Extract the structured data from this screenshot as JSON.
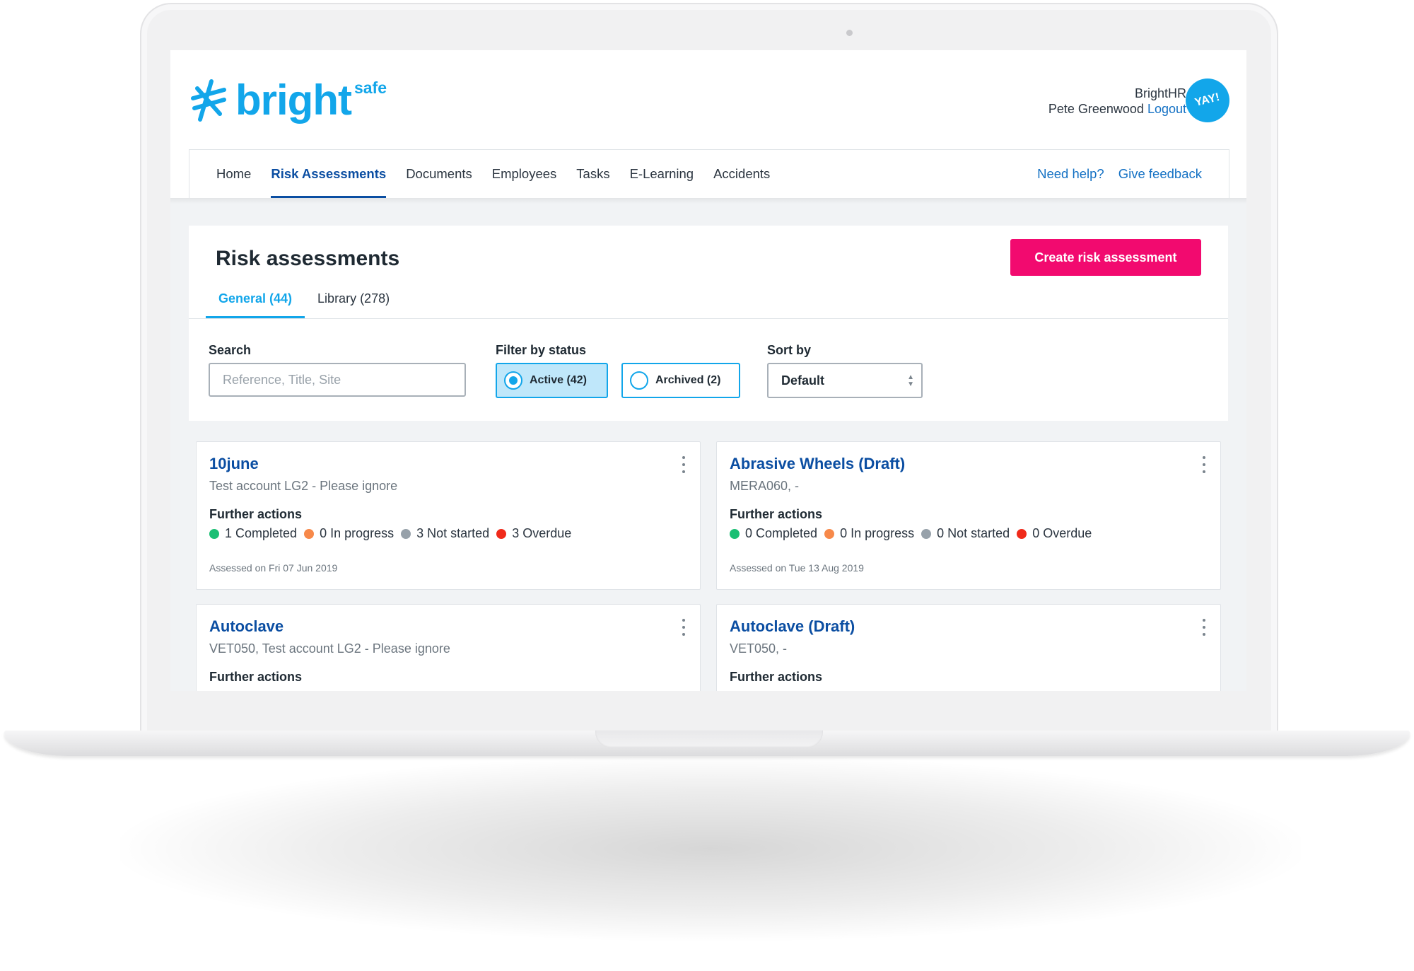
{
  "app": {
    "logo_text": "bright",
    "logo_suffix": "safe",
    "company": "BrightHR",
    "user_name": "Pete Greenwood",
    "logout_label": "Logout",
    "avatar_text": "YAY!"
  },
  "nav": {
    "items": [
      "Home",
      "Risk Assessments",
      "Documents",
      "Employees",
      "Tasks",
      "E-Learning",
      "Accidents"
    ],
    "active": "Risk Assessments",
    "help_label": "Need help?",
    "feedback_label": "Give feedback"
  },
  "page": {
    "title": "Risk assessments",
    "create_button": "Create risk assessment",
    "tabs": [
      "General (44)",
      "Library (278)"
    ],
    "active_tab": "General (44)"
  },
  "filters": {
    "search_label": "Search",
    "search_placeholder": "Reference, Title, Site",
    "status_label": "Filter by status",
    "status_options": [
      "Active (42)",
      "Archived (2)"
    ],
    "status_selected": "Active (42)",
    "sort_label": "Sort by",
    "sort_value": "Default"
  },
  "cards": [
    {
      "title": "10june",
      "subtitle": "Test account LG2 - Please ignore",
      "further_actions_label": "Further actions",
      "stats": [
        "1 Completed",
        "0 In progress",
        "3 Not started",
        "3 Overdue"
      ],
      "assessed": "Assessed on Fri 07 Jun 2019"
    },
    {
      "title": "Abrasive Wheels (Draft)",
      "subtitle": "MERA060, -",
      "further_actions_label": "Further actions",
      "stats": [
        "0 Completed",
        "0 In progress",
        "0 Not started",
        "0 Overdue"
      ],
      "assessed": "Assessed on Tue 13 Aug 2019"
    },
    {
      "title": "Autoclave",
      "subtitle": "VET050, Test account LG2 - Please ignore",
      "further_actions_label": "Further actions"
    },
    {
      "title": "Autoclave (Draft)",
      "subtitle": "VET050, -",
      "further_actions_label": "Further actions"
    }
  ],
  "colors": {
    "brand": "#12a6ea",
    "nav_active": "#0b4ea2",
    "primary_button": "#f20a6f",
    "completed": "#1bbf74",
    "in_progress": "#f7894a",
    "not_started": "#97a1aa",
    "overdue": "#f02a1a"
  },
  "icons": {
    "logo": "starburst-logo-icon",
    "avatar": "speech-bubble-icon",
    "card_menu": "kebab-menu-icon",
    "select": "sort-arrows-icon"
  }
}
